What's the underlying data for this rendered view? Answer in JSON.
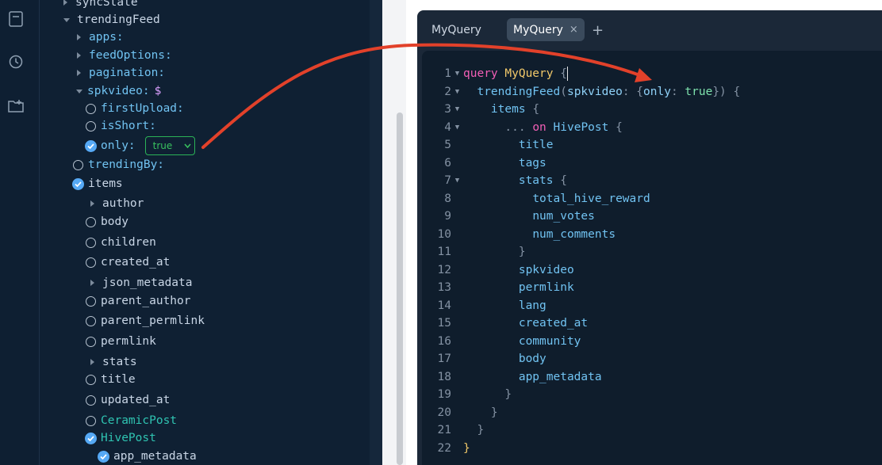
{
  "explorer": {
    "rows": [
      {
        "label": "syncState"
      },
      {
        "label": "trendingFeed"
      },
      {
        "label": "apps:"
      },
      {
        "label": "feedOptions:"
      },
      {
        "label": "pagination:"
      },
      {
        "label": "spkvideo:",
        "type": "$"
      },
      {
        "label": "firstUpload:"
      },
      {
        "label": "isShort:"
      },
      {
        "label": "only:",
        "select_value": "true"
      },
      {
        "label": "trendingBy:"
      },
      {
        "label": "items"
      },
      {
        "label": "author"
      },
      {
        "label": "body"
      },
      {
        "label": "children"
      },
      {
        "label": "created_at"
      },
      {
        "label": "json_metadata"
      },
      {
        "label": "parent_author"
      },
      {
        "label": "parent_permlink"
      },
      {
        "label": "permlink"
      },
      {
        "label": "stats"
      },
      {
        "label": "title"
      },
      {
        "label": "updated_at"
      },
      {
        "label": "CeramicPost"
      },
      {
        "label": "HivePost"
      },
      {
        "label": "app_metadata"
      }
    ]
  },
  "tabs": [
    {
      "label": "MyQuery"
    },
    {
      "label": "MyQuery",
      "close": "×"
    }
  ],
  "add_tab": "+",
  "editor": {
    "lines": [
      {
        "n": "1"
      },
      {
        "n": "2"
      },
      {
        "n": "3"
      },
      {
        "n": "4"
      },
      {
        "n": "5"
      },
      {
        "n": "6"
      },
      {
        "n": "7"
      },
      {
        "n": "8"
      },
      {
        "n": "9"
      },
      {
        "n": "10"
      },
      {
        "n": "11"
      },
      {
        "n": "12"
      },
      {
        "n": "13"
      },
      {
        "n": "14"
      },
      {
        "n": "15"
      },
      {
        "n": "16"
      },
      {
        "n": "17"
      },
      {
        "n": "18"
      },
      {
        "n": "19"
      },
      {
        "n": "20"
      },
      {
        "n": "21"
      },
      {
        "n": "22"
      }
    ],
    "tokens": {
      "query": "query",
      "MyQuery": "MyQuery",
      "trendingFeed": "trendingFeed",
      "spkvideo_arg": "spkvideo",
      "only": "only",
      "true": "true",
      "items": "items",
      "ellipsis": "...",
      "on": "on",
      "HivePost": "HivePost",
      "title": "title",
      "tags": "tags",
      "stats": "stats",
      "total_hive_reward": "total_hive_reward",
      "num_votes": "num_votes",
      "num_comments": "num_comments",
      "spkvideo": "spkvideo",
      "permlink": "permlink",
      "lang": "lang",
      "created_at": "created_at",
      "community": "community",
      "body": "body",
      "app_metadata": "app_metadata"
    }
  },
  "colors": {
    "accent_blue": "#56a9f5",
    "annotation_arrow": "#e2412a",
    "select_green": "#38c25f"
  }
}
